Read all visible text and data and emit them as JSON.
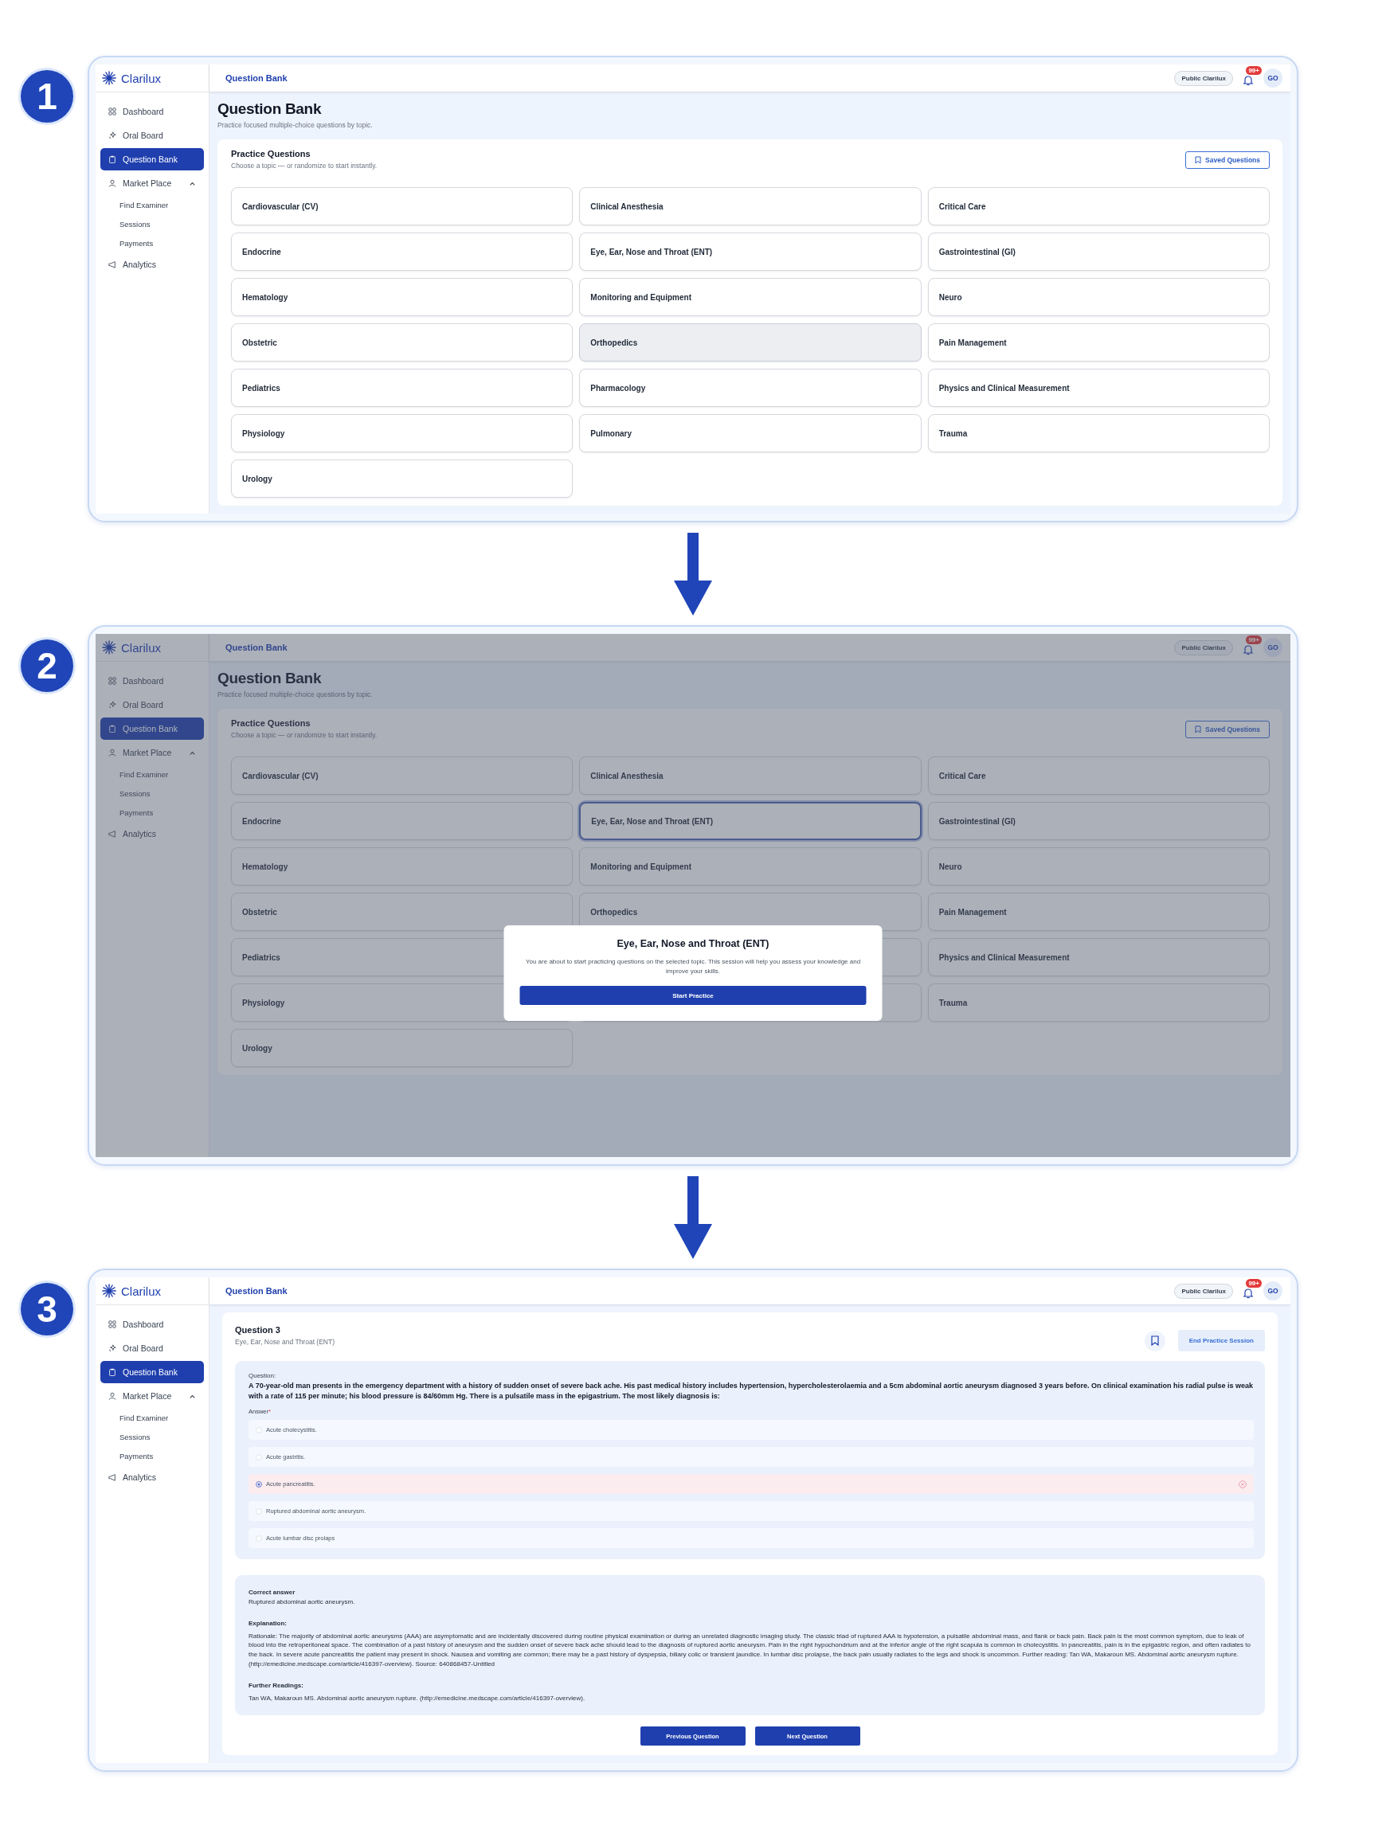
{
  "steps": [
    {
      "number": "1",
      "kind": "topics",
      "app": {
        "brand": "Clarilux",
        "breadcrumb": "Question Bank",
        "workspace": "Public Clarilux",
        "notifications": "99+",
        "avatar": "GO",
        "nav": [
          {
            "label": "Dashboard",
            "selected": false
          },
          {
            "label": "Oral Board",
            "selected": false
          },
          {
            "label": "Question Bank",
            "selected": true
          },
          {
            "label": "Market Place",
            "selected": false,
            "expanded": true,
            "children": [
              {
                "label": "Find Examiner",
                "selected": false
              },
              {
                "label": "Sessions",
                "selected": false
              },
              {
                "label": "Payments",
                "selected": false
              }
            ]
          },
          {
            "label": "Analytics",
            "selected": false
          }
        ]
      },
      "page": {
        "title": "Question Bank",
        "subtitle": "Practice focused multiple-choice questions by topic.",
        "card_title": "Practice Questions",
        "card_subtitle": "Choose a topic — or randomize to start instantly.",
        "saved_button": "Saved Questions",
        "topics": [
          {
            "label": "Cardiovascular (CV)",
            "selected": false,
            "hovered": false
          },
          {
            "label": "Clinical Anesthesia",
            "selected": false,
            "hovered": false
          },
          {
            "label": "Critical Care",
            "selected": false,
            "hovered": false
          },
          {
            "label": "Endocrine",
            "selected": false,
            "hovered": false
          },
          {
            "label": "Eye, Ear, Nose and Throat (ENT)",
            "selected": false,
            "hovered": false
          },
          {
            "label": "Gastrointestinal (GI)",
            "selected": false,
            "hovered": false
          },
          {
            "label": "Hematology",
            "selected": false,
            "hovered": false
          },
          {
            "label": "Monitoring and Equipment",
            "selected": false,
            "hovered": false
          },
          {
            "label": "Neuro",
            "selected": false,
            "hovered": false
          },
          {
            "label": "Obstetric",
            "selected": false,
            "hovered": false
          },
          {
            "label": "Orthopedics",
            "selected": false,
            "hovered": true
          },
          {
            "label": "Pain Management",
            "selected": false,
            "hovered": false
          },
          {
            "label": "Pediatrics",
            "selected": false,
            "hovered": false
          },
          {
            "label": "Pharmacology",
            "selected": false,
            "hovered": false
          },
          {
            "label": "Physics and Clinical Measurement",
            "selected": false,
            "hovered": false
          },
          {
            "label": "Physiology",
            "selected": false,
            "hovered": false
          },
          {
            "label": "Pulmonary",
            "selected": false,
            "hovered": false
          },
          {
            "label": "Trauma",
            "selected": false,
            "hovered": false
          },
          {
            "label": "Urology",
            "selected": false,
            "hovered": false
          }
        ]
      }
    },
    {
      "number": "2",
      "kind": "topics",
      "app": {
        "brand": "Clarilux",
        "breadcrumb": "Question Bank",
        "workspace": "Public Clarilux",
        "notifications": "99+",
        "avatar": "GO",
        "nav": [
          {
            "label": "Dashboard",
            "selected": false
          },
          {
            "label": "Oral Board",
            "selected": false
          },
          {
            "label": "Question Bank",
            "selected": true
          },
          {
            "label": "Market Place",
            "selected": false,
            "expanded": true,
            "children": [
              {
                "label": "Find Examiner",
                "selected": false
              },
              {
                "label": "Sessions",
                "selected": false
              },
              {
                "label": "Payments",
                "selected": false
              }
            ]
          },
          {
            "label": "Analytics",
            "selected": false
          }
        ]
      },
      "page": {
        "title": "Question Bank",
        "subtitle": "Practice focused multiple-choice questions by topic.",
        "card_title": "Practice Questions",
        "card_subtitle": "Choose a topic — or randomize to start instantly.",
        "saved_button": "Saved Questions",
        "topics": [
          {
            "label": "Cardiovascular (CV)",
            "selected": false
          },
          {
            "label": "Clinical Anesthesia",
            "selected": false
          },
          {
            "label": "Critical Care",
            "selected": false
          },
          {
            "label": "Endocrine",
            "selected": false
          },
          {
            "label": "Eye, Ear, Nose and Throat (ENT)",
            "selected": true
          },
          {
            "label": "Gastrointestinal (GI)",
            "selected": false
          },
          {
            "label": "Hematology",
            "selected": false
          },
          {
            "label": "Monitoring and Equipment",
            "selected": false
          },
          {
            "label": "Neuro",
            "selected": false
          },
          {
            "label": "Obstetric",
            "selected": false
          },
          {
            "label": "Orthopedics",
            "selected": false
          },
          {
            "label": "Pain Management",
            "selected": false
          },
          {
            "label": "Pediatrics",
            "selected": false
          },
          {
            "selected": false
          },
          {
            "label": "Physics and Clinical Measurement",
            "selected": false
          },
          {
            "label": "Physiology",
            "selected": false
          },
          {
            "selected": false
          },
          {
            "label": "Trauma",
            "selected": false
          },
          {
            "label": "Urology",
            "selected": false
          }
        ]
      },
      "modal": {
        "title": "Eye, Ear, Nose and Throat (ENT)",
        "text": "You are about to start practicing questions on the selected topic. This session will help you assess your knowledge and improve your skills.",
        "button": "Start Practice"
      }
    },
    {
      "number": "3",
      "kind": "question",
      "app": {
        "brand": "Clarilux",
        "breadcrumb": "Question Bank",
        "workspace": "Public Clarilux",
        "notifications": "99+",
        "avatar": "GO",
        "nav": [
          {
            "label": "Dashboard",
            "selected": false
          },
          {
            "label": "Oral Board",
            "selected": false
          },
          {
            "label": "Question Bank",
            "selected": true
          },
          {
            "label": "Market Place",
            "selected": false,
            "expanded": true,
            "children": [
              {
                "label": "Find Examiner",
                "selected": false
              },
              {
                "label": "Sessions",
                "selected": false
              },
              {
                "label": "Payments",
                "selected": false
              }
            ]
          },
          {
            "label": "Analytics",
            "selected": false
          }
        ]
      },
      "question": {
        "title": "Question 3",
        "topic": "Eye, Ear, Nose and Throat (ENT)",
        "end_button": "End Practice Session",
        "question_label": "Question:",
        "question_text": "A 70-year-old man presents in the emergency department with a history of sudden onset of severe back ache. His past medical history includes hypertension, hypercholesterolaemia and a 5cm abdominal aortic aneurysm diagnosed 3 years before. On clinical examination his radial pulse is weak with a rate of 115 per minute; his blood pressure is 84/60mm Hg. There is a pulsatile mass in the epigastrium. The most likely diagnosis is:",
        "answer_label": "Answer",
        "required_mark": "*",
        "options": [
          {
            "label": "Acute cholecystitis.",
            "selected": false,
            "incorrect": false
          },
          {
            "label": "Acute gastritis.",
            "selected": false,
            "incorrect": false
          },
          {
            "label": "Acute pancreatitis.",
            "selected": true,
            "incorrect": true
          },
          {
            "label": "Ruptured abdominal aortic aneurysm.",
            "selected": false,
            "incorrect": false
          },
          {
            "label": "Acute lumbar disc prolaps",
            "selected": false,
            "incorrect": false
          }
        ],
        "correct_label": "Correct answer",
        "correct_answer": "Ruptured abdominal aortic aneurysm.",
        "explanation_label": "Explanation:",
        "explanation": "Rationale: The majority of abdominal aortic aneurysms (AAA) are asymptomatic and are incidentally discovered during routine physical examination or during an unrelated diagnostic imaging study. The classic triad of ruptured AAA is hypotension, a pulsatile abdominal mass, and flank or back pain. Back pain is the most common symptom, due to leak of blood into the retroperitoneal space. The combination of a past history of aneurysm and the sudden onset of severe back ache should lead to the diagnosis of ruptured aortic aneurysm. Pain in the right hypochondrium and at the inferior angle of the right scapula is common in cholecystitis. In pancreatitis, pain is in the epigastric region, and often radiates to the back. In severe acute pancreatitis the patient may present in shock. Nausea and vomiting are common; there may be a past history of dyspepsia, biliary colic or transient jaundice. In lumbar disc prolapse, the back pain usually radiates to the legs and shock is uncommon. Further reading: Tan WA, Makaroun MS. Abdominal aortic aneurysm rupture. (http://emedicine.medscape.com/article/416397-overview). Source: 640868457-Untitled",
        "further_label": "Further Readings:",
        "further_text": "Tan WA, Makaroun MS. Abdominal aortic aneurysm rupture. (http://emedicine.medscape.com/article/416397-overview).",
        "prev_button": "Previous Question",
        "next_button": "Next Question"
      }
    }
  ]
}
